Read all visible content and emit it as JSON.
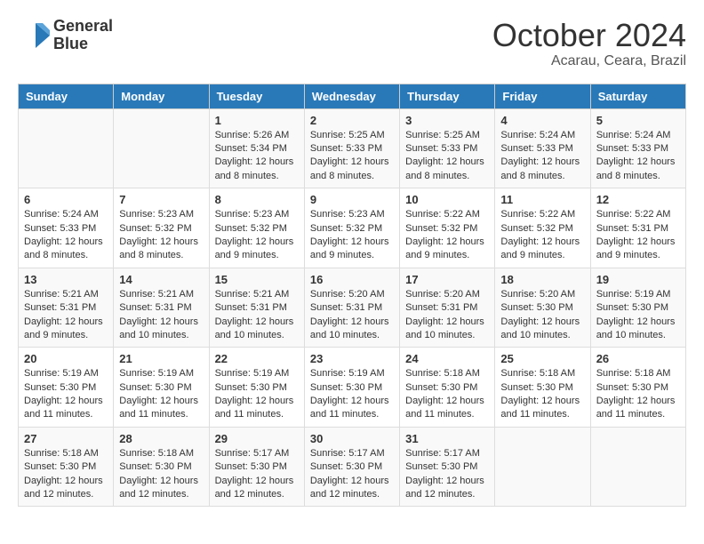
{
  "header": {
    "logo_line1": "General",
    "logo_line2": "Blue",
    "month_year": "October 2024",
    "location": "Acarau, Ceara, Brazil"
  },
  "days_of_week": [
    "Sunday",
    "Monday",
    "Tuesday",
    "Wednesday",
    "Thursday",
    "Friday",
    "Saturday"
  ],
  "weeks": [
    [
      {
        "num": "",
        "info": ""
      },
      {
        "num": "",
        "info": ""
      },
      {
        "num": "1",
        "info": "Sunrise: 5:26 AM\nSunset: 5:34 PM\nDaylight: 12 hours and 8 minutes."
      },
      {
        "num": "2",
        "info": "Sunrise: 5:25 AM\nSunset: 5:33 PM\nDaylight: 12 hours and 8 minutes."
      },
      {
        "num": "3",
        "info": "Sunrise: 5:25 AM\nSunset: 5:33 PM\nDaylight: 12 hours and 8 minutes."
      },
      {
        "num": "4",
        "info": "Sunrise: 5:24 AM\nSunset: 5:33 PM\nDaylight: 12 hours and 8 minutes."
      },
      {
        "num": "5",
        "info": "Sunrise: 5:24 AM\nSunset: 5:33 PM\nDaylight: 12 hours and 8 minutes."
      }
    ],
    [
      {
        "num": "6",
        "info": "Sunrise: 5:24 AM\nSunset: 5:33 PM\nDaylight: 12 hours and 8 minutes."
      },
      {
        "num": "7",
        "info": "Sunrise: 5:23 AM\nSunset: 5:32 PM\nDaylight: 12 hours and 8 minutes."
      },
      {
        "num": "8",
        "info": "Sunrise: 5:23 AM\nSunset: 5:32 PM\nDaylight: 12 hours and 9 minutes."
      },
      {
        "num": "9",
        "info": "Sunrise: 5:23 AM\nSunset: 5:32 PM\nDaylight: 12 hours and 9 minutes."
      },
      {
        "num": "10",
        "info": "Sunrise: 5:22 AM\nSunset: 5:32 PM\nDaylight: 12 hours and 9 minutes."
      },
      {
        "num": "11",
        "info": "Sunrise: 5:22 AM\nSunset: 5:32 PM\nDaylight: 12 hours and 9 minutes."
      },
      {
        "num": "12",
        "info": "Sunrise: 5:22 AM\nSunset: 5:31 PM\nDaylight: 12 hours and 9 minutes."
      }
    ],
    [
      {
        "num": "13",
        "info": "Sunrise: 5:21 AM\nSunset: 5:31 PM\nDaylight: 12 hours and 9 minutes."
      },
      {
        "num": "14",
        "info": "Sunrise: 5:21 AM\nSunset: 5:31 PM\nDaylight: 12 hours and 10 minutes."
      },
      {
        "num": "15",
        "info": "Sunrise: 5:21 AM\nSunset: 5:31 PM\nDaylight: 12 hours and 10 minutes."
      },
      {
        "num": "16",
        "info": "Sunrise: 5:20 AM\nSunset: 5:31 PM\nDaylight: 12 hours and 10 minutes."
      },
      {
        "num": "17",
        "info": "Sunrise: 5:20 AM\nSunset: 5:31 PM\nDaylight: 12 hours and 10 minutes."
      },
      {
        "num": "18",
        "info": "Sunrise: 5:20 AM\nSunset: 5:30 PM\nDaylight: 12 hours and 10 minutes."
      },
      {
        "num": "19",
        "info": "Sunrise: 5:19 AM\nSunset: 5:30 PM\nDaylight: 12 hours and 10 minutes."
      }
    ],
    [
      {
        "num": "20",
        "info": "Sunrise: 5:19 AM\nSunset: 5:30 PM\nDaylight: 12 hours and 11 minutes."
      },
      {
        "num": "21",
        "info": "Sunrise: 5:19 AM\nSunset: 5:30 PM\nDaylight: 12 hours and 11 minutes."
      },
      {
        "num": "22",
        "info": "Sunrise: 5:19 AM\nSunset: 5:30 PM\nDaylight: 12 hours and 11 minutes."
      },
      {
        "num": "23",
        "info": "Sunrise: 5:19 AM\nSunset: 5:30 PM\nDaylight: 12 hours and 11 minutes."
      },
      {
        "num": "24",
        "info": "Sunrise: 5:18 AM\nSunset: 5:30 PM\nDaylight: 12 hours and 11 minutes."
      },
      {
        "num": "25",
        "info": "Sunrise: 5:18 AM\nSunset: 5:30 PM\nDaylight: 12 hours and 11 minutes."
      },
      {
        "num": "26",
        "info": "Sunrise: 5:18 AM\nSunset: 5:30 PM\nDaylight: 12 hours and 11 minutes."
      }
    ],
    [
      {
        "num": "27",
        "info": "Sunrise: 5:18 AM\nSunset: 5:30 PM\nDaylight: 12 hours and 12 minutes."
      },
      {
        "num": "28",
        "info": "Sunrise: 5:18 AM\nSunset: 5:30 PM\nDaylight: 12 hours and 12 minutes."
      },
      {
        "num": "29",
        "info": "Sunrise: 5:17 AM\nSunset: 5:30 PM\nDaylight: 12 hours and 12 minutes."
      },
      {
        "num": "30",
        "info": "Sunrise: 5:17 AM\nSunset: 5:30 PM\nDaylight: 12 hours and 12 minutes."
      },
      {
        "num": "31",
        "info": "Sunrise: 5:17 AM\nSunset: 5:30 PM\nDaylight: 12 hours and 12 minutes."
      },
      {
        "num": "",
        "info": ""
      },
      {
        "num": "",
        "info": ""
      }
    ]
  ]
}
